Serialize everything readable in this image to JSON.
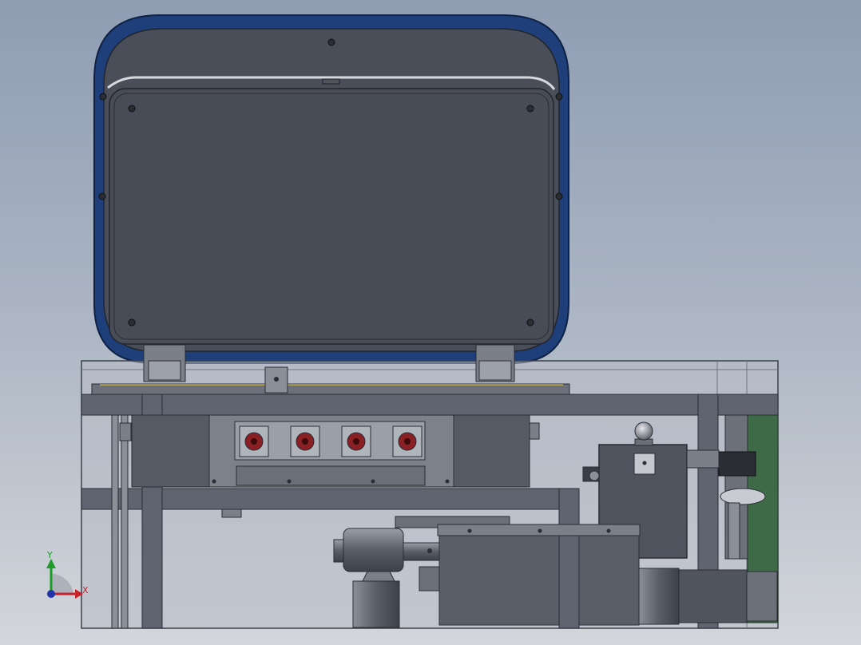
{
  "viewport": {
    "background_top": "#8f9db3",
    "background_bottom": "#d3d6db"
  },
  "model": {
    "lid_accent": "#1f3f7a",
    "lid_panel": "#4a4e58",
    "frame_color": "#5f6470",
    "enclosure_glass": "#b7bcc6",
    "valve_red": "#8a1f24",
    "motor_color": "#6c7078",
    "green_plate": "#3f6a48"
  },
  "triad": {
    "y_label": "Y",
    "x_label": "X",
    "y_color": "#1f9a2a",
    "x_color": "#c8222a",
    "z_color": "#2233aa"
  }
}
